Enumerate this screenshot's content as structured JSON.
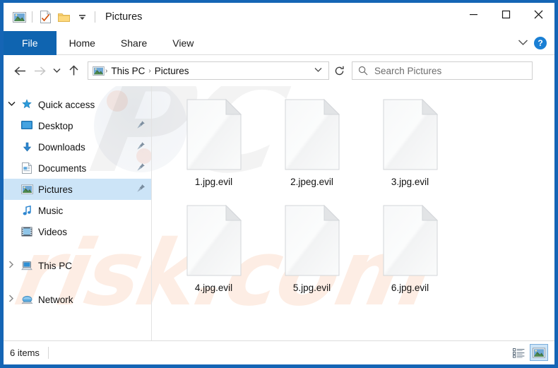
{
  "window": {
    "title": "Pictures",
    "accent_color": "#1565b5",
    "file_tab_color": "#0f64b0",
    "selection_color": "#cce4f7"
  },
  "quick_access_toolbar": {
    "items": [
      {
        "name": "pictures-folder-icon",
        "label": "Pictures"
      },
      {
        "name": "properties-icon",
        "label": "Properties"
      },
      {
        "name": "new-folder-icon",
        "label": "New folder"
      },
      {
        "name": "customize-dropdown-icon",
        "label": "Customize Quick Access Toolbar"
      }
    ]
  },
  "window_controls": {
    "minimize": "─",
    "maximize": "☐",
    "close": "✕"
  },
  "ribbon": {
    "tabs": [
      {
        "label": "File",
        "active": true
      },
      {
        "label": "Home",
        "active": false
      },
      {
        "label": "Share",
        "active": false
      },
      {
        "label": "View",
        "active": false
      }
    ],
    "expand_icon": "chevron-down-icon",
    "help_label": "?"
  },
  "addressbar": {
    "back_icon": "←",
    "forward_icon": "→",
    "recent_icon": "⌄",
    "up_icon": "↑",
    "breadcrumb": [
      {
        "label": "This PC"
      },
      {
        "label": "Pictures"
      }
    ],
    "breadcrumb_separator": "›",
    "dropdown_icon": "⌄",
    "refresh_icon": "↻"
  },
  "search": {
    "placeholder": "Search Pictures",
    "icon": "search-icon"
  },
  "sidebar": {
    "groups": [
      {
        "label": "Quick access",
        "icon": "star-pin-icon",
        "expanded": true,
        "chevron": "⌄",
        "items": [
          {
            "label": "Desktop",
            "icon": "desktop-icon",
            "pinned": true,
            "selected": false
          },
          {
            "label": "Downloads",
            "icon": "downloads-icon",
            "pinned": true,
            "selected": false
          },
          {
            "label": "Documents",
            "icon": "documents-icon",
            "pinned": true,
            "selected": false
          },
          {
            "label": "Pictures",
            "icon": "pictures-icon",
            "pinned": true,
            "selected": true
          },
          {
            "label": "Music",
            "icon": "music-icon",
            "pinned": false,
            "selected": false
          },
          {
            "label": "Videos",
            "icon": "videos-icon",
            "pinned": false,
            "selected": false
          }
        ]
      },
      {
        "label": "This PC",
        "icon": "this-pc-icon",
        "expanded": false,
        "chevron": "›",
        "items": []
      },
      {
        "label": "Network",
        "icon": "network-icon",
        "expanded": false,
        "chevron": "›",
        "items": []
      }
    ]
  },
  "files": {
    "items": [
      {
        "name": "1.jpg.evil",
        "icon": "blank-document-icon"
      },
      {
        "name": "2.jpeg.evil",
        "icon": "blank-document-icon"
      },
      {
        "name": "3.jpg.evil",
        "icon": "blank-document-icon"
      },
      {
        "name": "4.jpg.evil",
        "icon": "blank-document-icon"
      },
      {
        "name": "5.jpg.evil",
        "icon": "blank-document-icon"
      },
      {
        "name": "6.jpg.evil",
        "icon": "blank-document-icon"
      }
    ]
  },
  "status": {
    "item_count": "6 items",
    "views": [
      {
        "name": "details-view-button",
        "active": false
      },
      {
        "name": "large-icons-view-button",
        "active": true
      }
    ]
  },
  "watermark": {
    "text_top": "PC",
    "text_bottom": "risk.com"
  }
}
